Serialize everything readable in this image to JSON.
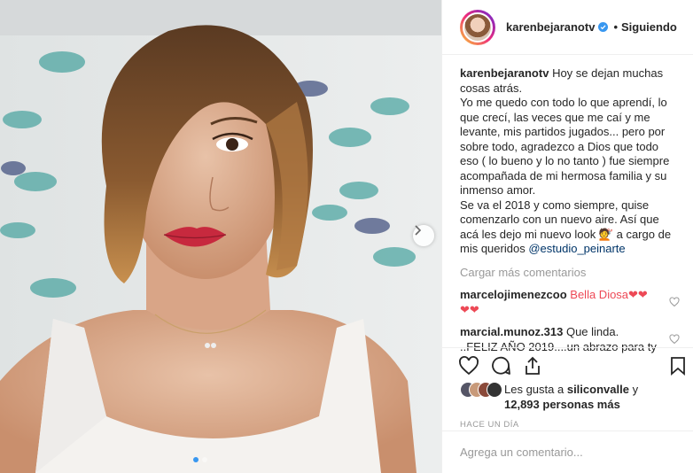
{
  "post": {
    "username": "karenbejaranotv",
    "follow_status": "Siguiendo",
    "separator": "•",
    "caption_lines": [
      "Hoy se dejan muchas cosas atrás.",
      "Yo me quedo con todo lo que aprendí, lo que crecí, las veces que me caí y me levante, mis partidos jugados... pero por sobre todo, agradezco a Dios que todo eso ( lo bueno y lo no tanto ) fue siempre acompañada de mi hermosa familia y su inmenso amor.",
      "Se va el 2018 y como siempre, quise comenzarlo con un nuevo aire. Así que acá les dejo mi nuevo look 💇 a cargo de mis queridos"
    ],
    "caption_mention": "@estudio_peinarte",
    "load_more": "Cargar más comentarios",
    "comments": [
      {
        "user": "marcelojimenezcoo",
        "text": "Bella Diosa❤❤ ❤❤"
      },
      {
        "user": "marcial.munoz.313",
        "text": "Que linda. ..FELIZ AÑO 2019....un abrazo para ty"
      }
    ],
    "likes_line1": "Les gusta a",
    "likes_user": "siliconvalle",
    "likes_line2": "y",
    "likes_count": "12,893 personas más",
    "timestamp": "HACE UN DÍA",
    "comment_placeholder": "Agrega un comentario..."
  },
  "colors": {
    "accent": "#3897f0",
    "heart": "#ed4956",
    "text": "#262626",
    "muted": "#999999",
    "link": "#003569"
  },
  "icons": [
    "verified-badge-icon",
    "chevron-right-icon",
    "heart-icon",
    "comment-icon",
    "share-icon",
    "bookmark-icon"
  ],
  "carousel": {
    "count": 2,
    "current": 1
  }
}
